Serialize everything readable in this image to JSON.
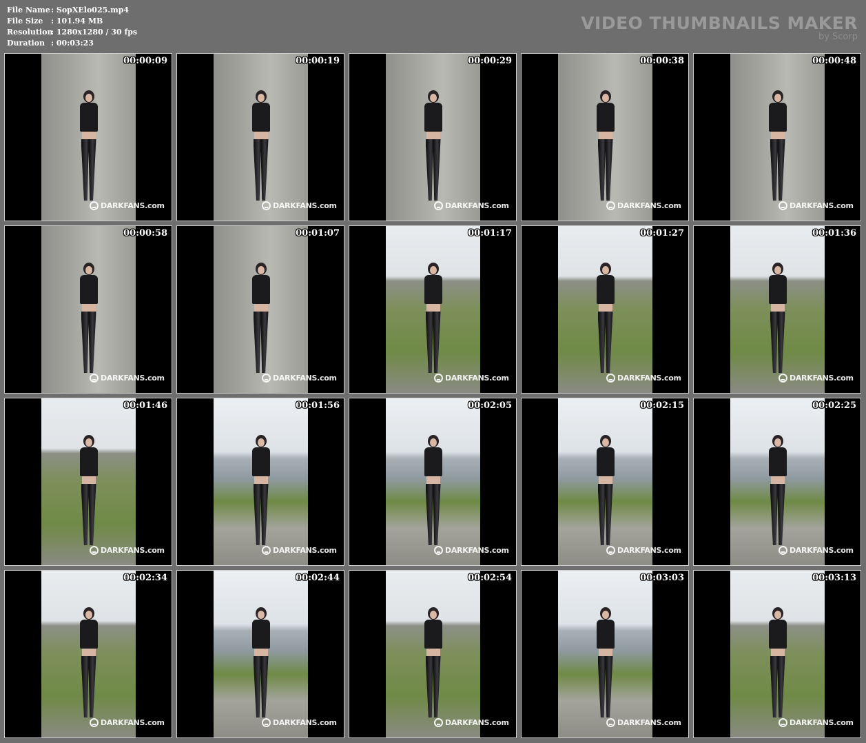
{
  "header": {
    "file_name_label": "File Name",
    "file_name": ":  SopXElo025.mp4",
    "file_size_label": "File Size",
    "file_size": ":  101.94 MB",
    "resolution_label": "Resolution",
    "resolution": ":  1280x1280 / 30 fps",
    "duration_label": "Duration",
    "duration": ":  00:03:23"
  },
  "brand": {
    "title": "VIDEO THUMBNAILS MAKER",
    "byline": "by Scorp"
  },
  "watermark": "DARKFANS.com",
  "thumbnails": [
    {
      "time": "00:00:09",
      "scene": "wall"
    },
    {
      "time": "00:00:19",
      "scene": "wall"
    },
    {
      "time": "00:00:29",
      "scene": "wall"
    },
    {
      "time": "00:00:38",
      "scene": "wall"
    },
    {
      "time": "00:00:48",
      "scene": "wall"
    },
    {
      "time": "00:00:58",
      "scene": "wall"
    },
    {
      "time": "00:01:07",
      "scene": "wall"
    },
    {
      "time": "00:01:17",
      "scene": "grass"
    },
    {
      "time": "00:01:27",
      "scene": "grass"
    },
    {
      "time": "00:01:36",
      "scene": "grass"
    },
    {
      "time": "00:01:46",
      "scene": "grass"
    },
    {
      "time": "00:01:56",
      "scene": "water"
    },
    {
      "time": "00:02:05",
      "scene": "water"
    },
    {
      "time": "00:02:15",
      "scene": "water"
    },
    {
      "time": "00:02:25",
      "scene": "water"
    },
    {
      "time": "00:02:34",
      "scene": "grass"
    },
    {
      "time": "00:02:44",
      "scene": "water"
    },
    {
      "time": "00:02:54",
      "scene": "grass"
    },
    {
      "time": "00:03:03",
      "scene": "water"
    },
    {
      "time": "00:03:13",
      "scene": "grass"
    }
  ]
}
